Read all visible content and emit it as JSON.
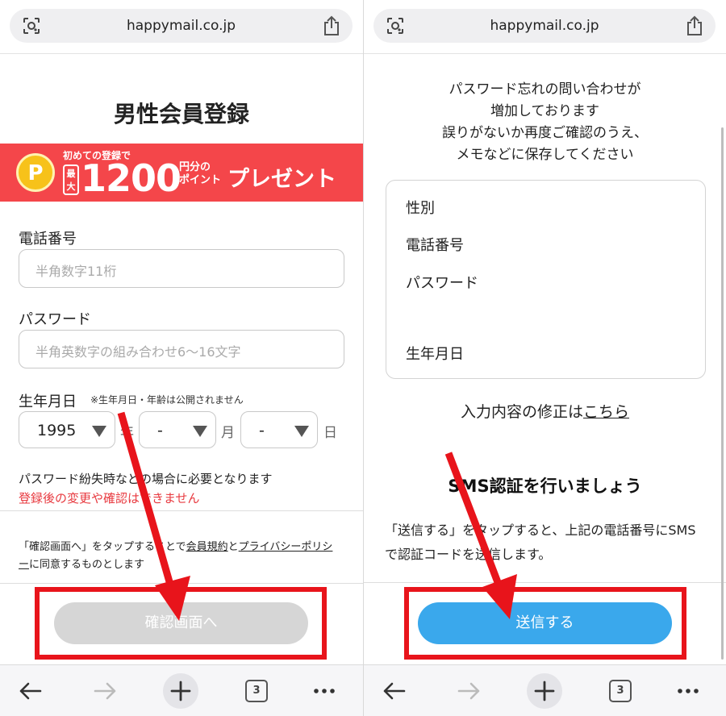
{
  "left": {
    "url": "happymail.co.jp",
    "title": "男性会員登録",
    "banner": {
      "small": "初めての登録で",
      "max": "最大",
      "amount": "1200",
      "unit_line1": "円分の",
      "unit_line2": "ポイント",
      "present": "プレゼント",
      "coin": "P"
    },
    "phone_label": "電話番号",
    "phone_placeholder": "半角数字11桁",
    "password_label": "パスワード",
    "password_placeholder": "半角英数字の組み合わせ6〜16文字",
    "birth_label": "生年月日",
    "birth_note": "※生年月日・年齢は公開されません",
    "year_value": "1995",
    "year_unit": "年",
    "month_value": "-",
    "month_unit": "月",
    "day_value": "-",
    "day_unit": "日",
    "info": "パスワード紛失時などの場合に必要となります",
    "warn": "登録後の変更や確認はできません",
    "agree_prefix": "「確認画面へ」をタップすることで",
    "agree_terms": "会員規約",
    "agree_and": "と",
    "agree_privacy": "プライバシーポリシー",
    "agree_suffix": "に同意するものとします",
    "confirm_button": "確認画面へ",
    "tab_count": "3"
  },
  "right": {
    "url": "happymail.co.jp",
    "head_line1": "パスワード忘れの問い合わせが",
    "head_line2": "増加しております",
    "head_line3": "誤りがないか再度ご確認のうえ、",
    "head_line4": "メモなどに保存してください",
    "item_gender": "性別",
    "item_phone": "電話番号",
    "item_password": "パスワード",
    "item_birth": "生年月日",
    "fix_prefix": "入力内容の修正は",
    "fix_link": "こちら",
    "sms_title": "SMS認証を行いましょう",
    "sms_desc": "「送信する」をタップすると、上記の電話番号にSMSで認証コードを送信します。",
    "send_button": "送信する",
    "tab_count": "3"
  },
  "colors": {
    "banner": "#f4464a",
    "warn": "#e8393f",
    "send_button": "#3aa8ec",
    "annotation": "#e8141b"
  }
}
